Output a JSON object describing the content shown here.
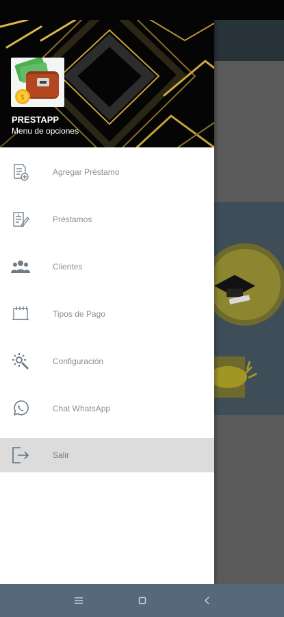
{
  "header": {
    "title": "PRESTAPP",
    "subtitle": "Menu de opciones",
    "logo_icon": "wallet-money-icon"
  },
  "menu": {
    "items": [
      {
        "label": "Agregar Préstamo",
        "icon": "add-document-icon"
      },
      {
        "label": "Préstamos",
        "icon": "loan-document-icon"
      },
      {
        "label": "Clientes",
        "icon": "users-group-icon"
      },
      {
        "label": "Tipos de Pago",
        "icon": "calendar-icon"
      },
      {
        "label": "Configuración",
        "icon": "settings-gear-icon"
      },
      {
        "label": "Chat WhatsApp",
        "icon": "whatsapp-icon"
      },
      {
        "label": "Salir",
        "icon": "logout-icon",
        "active": true
      }
    ]
  },
  "nav": {
    "buttons": [
      "menu",
      "home",
      "back"
    ]
  },
  "colors": {
    "header_bg": "#050505",
    "gold_accent": "#c9a23a",
    "active_item_bg": "#dcdcdc",
    "nav_bar": "#55697a",
    "menu_text": "#8e8e8e"
  }
}
